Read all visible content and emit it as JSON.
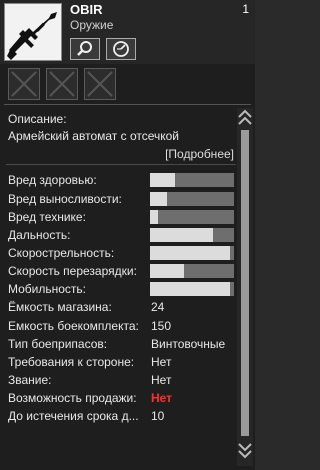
{
  "item": {
    "name": "OBIR",
    "type": "Оружие",
    "count": "1",
    "image_icon": "assault-rifle-icon"
  },
  "buttons": {
    "search_icon": "magnifier-icon",
    "compare_icon": "scales-icon"
  },
  "slots": [
    {
      "state": "empty"
    },
    {
      "state": "empty"
    },
    {
      "state": "empty"
    }
  ],
  "description": {
    "title": "Описание:",
    "text": "Армейский автомат с отсечкой",
    "more_link": "[Подробнее]"
  },
  "stats_bars": [
    {
      "label": "Вред здоровью:",
      "level": 0.3
    },
    {
      "label": "Вред выносливости:",
      "level": 0.2
    },
    {
      "label": "Вред технике:",
      "level": 0.1
    },
    {
      "label": "Дальность:",
      "level": 0.75
    },
    {
      "label": "Скорострельность:",
      "level": 0.95
    },
    {
      "label": "Скорость перезарядки:",
      "level": 0.4
    },
    {
      "label": "Мобильность:",
      "level": 0.95
    }
  ],
  "stats_values": [
    {
      "label": "Ёмкость магазина:",
      "value": "24"
    },
    {
      "label": "Емкость боекомплекта:",
      "value": "150"
    },
    {
      "label": "Тип боеприпасов:",
      "value": "Винтовочные"
    },
    {
      "label": "Требования к стороне:",
      "value": "Нет"
    },
    {
      "label": "Звание:",
      "value": "Нет"
    },
    {
      "label": "Возможность продажи:",
      "value": "Нет",
      "color": "#ff3030"
    },
    {
      "label": "До истечения срока д...",
      "value": "10"
    }
  ],
  "colors": {
    "background": "#1e1e1e",
    "bar_empty": "#6e6e6e",
    "bar_fill": "#dcdcdc",
    "negative": "#ff3030"
  }
}
